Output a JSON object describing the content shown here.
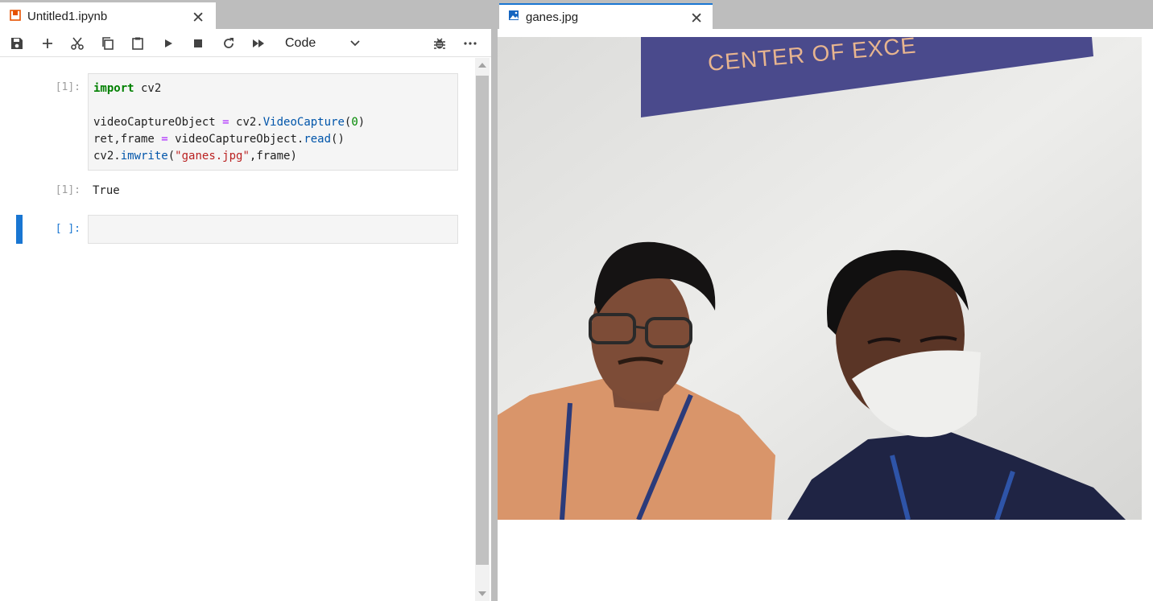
{
  "notebook_tab": {
    "label": "Untitled1.ipynb",
    "close": "✕"
  },
  "image_tab": {
    "label": "ganes.jpg",
    "close": "✕"
  },
  "toolbar": {
    "cell_type": "Code",
    "icons": [
      "save-icon",
      "add-icon",
      "cut-icon",
      "copy-icon",
      "paste-icon",
      "run-icon",
      "stop-icon",
      "restart-icon",
      "fast-forward-icon",
      "bug-icon",
      "more-icon"
    ]
  },
  "cells": [
    {
      "prompt": "[1]:",
      "code_lines": [
        "import cv2",
        "",
        "videoCaptureObject = cv2.VideoCapture(0)",
        "ret,frame = videoCaptureObject.read()",
        "cv2.imwrite(\"ganes.jpg\",frame)"
      ],
      "output_prompt": "[1]:",
      "output": "True"
    },
    {
      "prompt": "[ ]:",
      "code_lines": [
        ""
      ]
    }
  ],
  "photo": {
    "banner_text": "CENTER OF EXCE",
    "colors": {
      "banner": "#4a4a8c",
      "wall": "#e6e6e4",
      "shirt_left": "#d9956a",
      "shirt_right": "#1f2444"
    }
  },
  "colors": {
    "accent": "#1976d2",
    "chrome": "#bdbdbd"
  }
}
